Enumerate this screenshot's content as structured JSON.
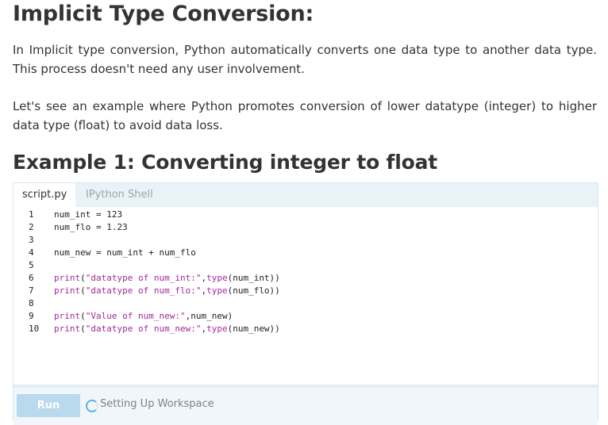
{
  "heading": "Implicit Type Conversion:",
  "paragraphs": [
    "In Implicit type conversion, Python automatically converts one data type to another data type. This process doesn't need any user involvement.",
    "Let's see an example where Python promotes conversion of lower datatype (integer) to higher data type (float) to avoid data loss."
  ],
  "example_heading": "Example 1: Converting integer to float",
  "editor": {
    "tabs": [
      {
        "label": "script.py",
        "active": true
      },
      {
        "label": "IPython Shell",
        "active": false
      }
    ],
    "lines": [
      {
        "n": "1",
        "parts": [
          [
            "num_int ",
            "p"
          ],
          [
            "= ",
            "o"
          ],
          [
            "123",
            "p"
          ]
        ]
      },
      {
        "n": "2",
        "parts": [
          [
            "num_flo ",
            "p"
          ],
          [
            "= ",
            "o"
          ],
          [
            "1.23",
            "p"
          ]
        ]
      },
      {
        "n": "3",
        "parts": []
      },
      {
        "n": "4",
        "parts": [
          [
            "num_new ",
            "p"
          ],
          [
            "= ",
            "o"
          ],
          [
            "num_int ",
            "p"
          ],
          [
            "+ ",
            "o"
          ],
          [
            "num_flo",
            "p"
          ]
        ]
      },
      {
        "n": "5",
        "parts": []
      },
      {
        "n": "6",
        "parts": [
          [
            "print",
            "k"
          ],
          [
            "(",
            "p"
          ],
          [
            "\"datatype of num_int:\"",
            "s"
          ],
          [
            ",",
            "p"
          ],
          [
            "type",
            "k"
          ],
          [
            "(num_int))",
            "p"
          ]
        ]
      },
      {
        "n": "7",
        "parts": [
          [
            "print",
            "k"
          ],
          [
            "(",
            "p"
          ],
          [
            "\"datatype of num_flo:\"",
            "s"
          ],
          [
            ",",
            "p"
          ],
          [
            "type",
            "k"
          ],
          [
            "(num_flo))",
            "p"
          ]
        ]
      },
      {
        "n": "8",
        "parts": []
      },
      {
        "n": "9",
        "parts": [
          [
            "print",
            "k"
          ],
          [
            "(",
            "p"
          ],
          [
            "\"Value of num_new:\"",
            "s"
          ],
          [
            ",num_new)",
            "p"
          ]
        ]
      },
      {
        "n": "10",
        "parts": [
          [
            "print",
            "k"
          ],
          [
            "(",
            "p"
          ],
          [
            "\"datatype of num_new:\"",
            "s"
          ],
          [
            ",",
            "p"
          ],
          [
            "type",
            "k"
          ],
          [
            "(num_new))",
            "p"
          ]
        ]
      }
    ],
    "run_label": "Run",
    "status": "Setting Up Workspace"
  }
}
